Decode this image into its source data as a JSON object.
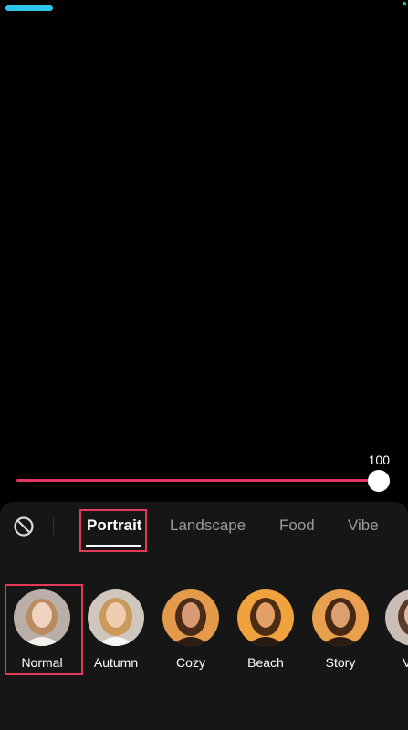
{
  "slider": {
    "value": "100",
    "level": 1.0
  },
  "tabs": [
    {
      "label": "Portrait",
      "active": true
    },
    {
      "label": "Landscape",
      "active": false
    },
    {
      "label": "Food",
      "active": false
    },
    {
      "label": "Vibe",
      "active": false
    }
  ],
  "filters": [
    {
      "label": "Normal",
      "selected": true
    },
    {
      "label": "Autumn",
      "selected": false
    },
    {
      "label": "Cozy",
      "selected": false
    },
    {
      "label": "Beach",
      "selected": false
    },
    {
      "label": "Story",
      "selected": false
    },
    {
      "label": "V",
      "selected": false
    }
  ],
  "colors": {
    "accent": "#e6335f",
    "highlight": "#e33a5a",
    "top_bar": "#2ec6e8"
  },
  "icons": {
    "none_filter": "no-filter-icon"
  }
}
